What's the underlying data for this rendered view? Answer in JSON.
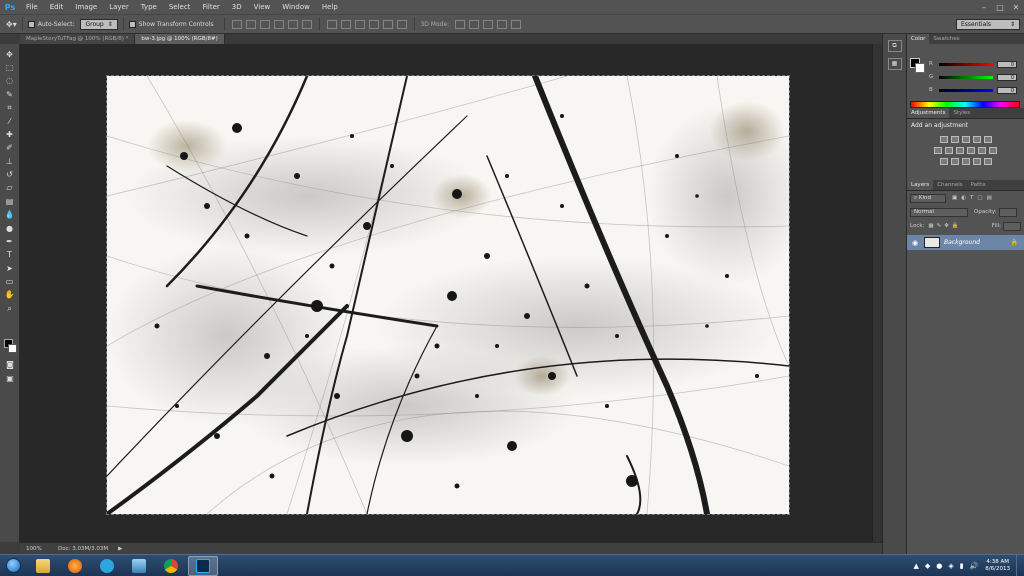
{
  "menu": {
    "app_icon": "Ps",
    "items": [
      "File",
      "Edit",
      "Image",
      "Layer",
      "Type",
      "Select",
      "Filter",
      "3D",
      "View",
      "Window",
      "Help"
    ]
  },
  "options": {
    "auto_select_label": "Auto-Select:",
    "auto_select_value": "Group",
    "show_transform_label": "Show Transform Controls",
    "mode_3d_label": "3D Mode:",
    "workspace": "Essentials"
  },
  "tabs": [
    {
      "label": "MapleStoryTuTFag @ 100% (RGB/8) *"
    },
    {
      "label": "bw-3.jpg @ 100% (RGB/8#)"
    }
  ],
  "status": {
    "zoom": "100%",
    "doc_info": "Doc: 3.03M/3.03M"
  },
  "panels": {
    "color_tabs": [
      "Color",
      "Swatches"
    ],
    "color": {
      "r_label": "R",
      "r_value": "0",
      "g_label": "G",
      "g_value": "0",
      "b_label": "B",
      "b_value": "0"
    },
    "adjust_tabs": [
      "Adjustments",
      "Styles"
    ],
    "adjust_title": "Add an adjustment",
    "layers_tabs": [
      "Layers",
      "Channels",
      "Paths"
    ],
    "layers": {
      "kind_label": "Kind",
      "blend_mode": "Normal",
      "opacity_label": "Opacity:",
      "lock_label": "Lock:",
      "fill_label": "Fill:",
      "items": [
        {
          "name": "Background"
        }
      ]
    }
  },
  "taskbar": {
    "time": "4:38 AM",
    "date": "8/6/2013"
  },
  "colors": {
    "accent": "#6d86a8",
    "ps_blue": "#31a8ff"
  }
}
